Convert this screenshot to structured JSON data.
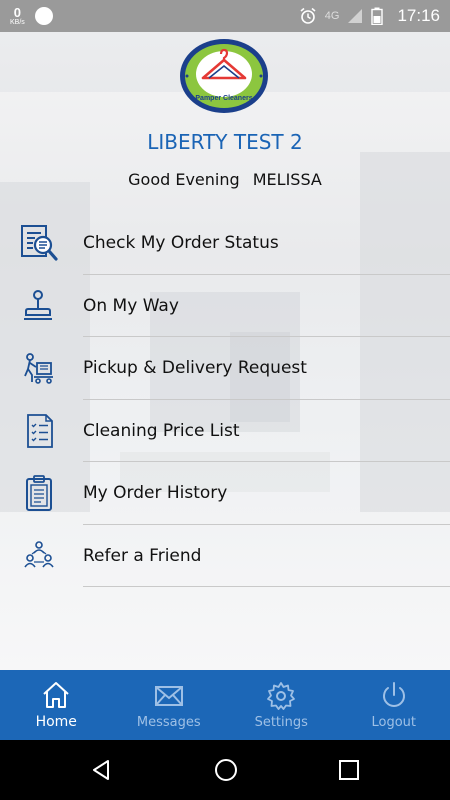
{
  "status_bar": {
    "net_speed": "0",
    "net_unit": "KB/s",
    "network": "4G",
    "time": "17:16"
  },
  "logo": {
    "text": "Pamper Cleaners"
  },
  "header": {
    "app_title": "LIBERTY TEST 2",
    "greeting": "Good Evening",
    "user_name": "MELISSA"
  },
  "menu": {
    "items": [
      {
        "label": "Check My Order Status",
        "icon": "order-search-icon"
      },
      {
        "label": "On My Way",
        "icon": "stamp-icon"
      },
      {
        "label": "Pickup & Delivery Request",
        "icon": "delivery-cart-icon"
      },
      {
        "label": "Cleaning Price List",
        "icon": "price-list-icon"
      },
      {
        "label": "My Order History",
        "icon": "clipboard-icon"
      },
      {
        "label": "Refer a Friend",
        "icon": "referral-icon"
      }
    ]
  },
  "bottom_nav": {
    "items": [
      {
        "label": "Home",
        "icon": "home-icon",
        "active": true
      },
      {
        "label": "Messages",
        "icon": "mail-icon",
        "active": false
      },
      {
        "label": "Settings",
        "icon": "gear-icon",
        "active": false
      },
      {
        "label": "Logout",
        "icon": "power-icon",
        "active": false
      }
    ]
  },
  "colors": {
    "accent": "#1c67b7",
    "title_blue": "#1a64b5",
    "logo_green": "#8cc63f",
    "logo_navy": "#1b3f8b",
    "logo_red": "#e53935"
  }
}
